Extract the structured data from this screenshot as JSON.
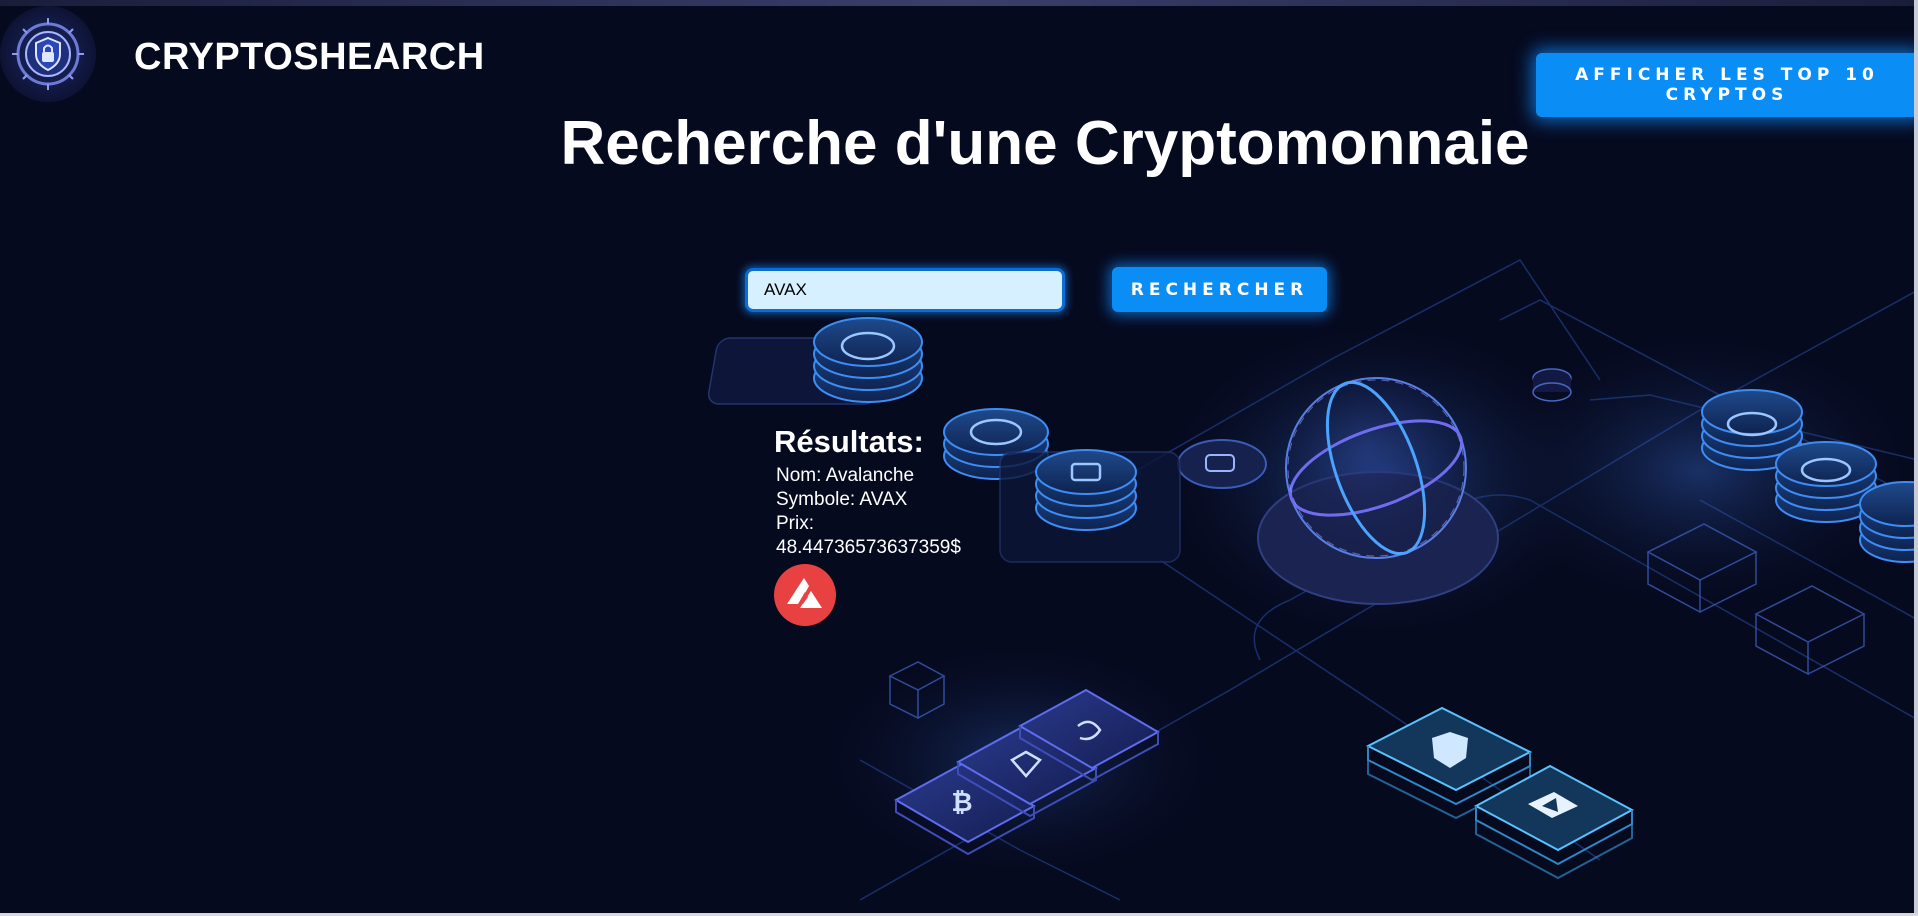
{
  "header": {
    "brand": "CRYPTOSHEARCH",
    "top10_button_label": "AFFICHER LES TOP 10 CRYPTOS"
  },
  "main": {
    "title": "Recherche d'une Cryptomonnaie",
    "search": {
      "value": "AVAX",
      "placeholder": "",
      "button_label": "RECHERCHER"
    },
    "results": {
      "heading": "Résultats:",
      "name_line": "Nom: Avalanche",
      "symbol_line": "Symbole: AVAX",
      "price_label": "Prix:",
      "price_value": "48.44736573637359$"
    }
  },
  "icons": {
    "logo": "shield-lock-icon",
    "result_logo": "avalanche-logo-icon"
  },
  "colors": {
    "background": "#060a1f",
    "accent": "#0a8df5",
    "input_background": "#d6f0ff",
    "avax_red": "#e84142"
  }
}
